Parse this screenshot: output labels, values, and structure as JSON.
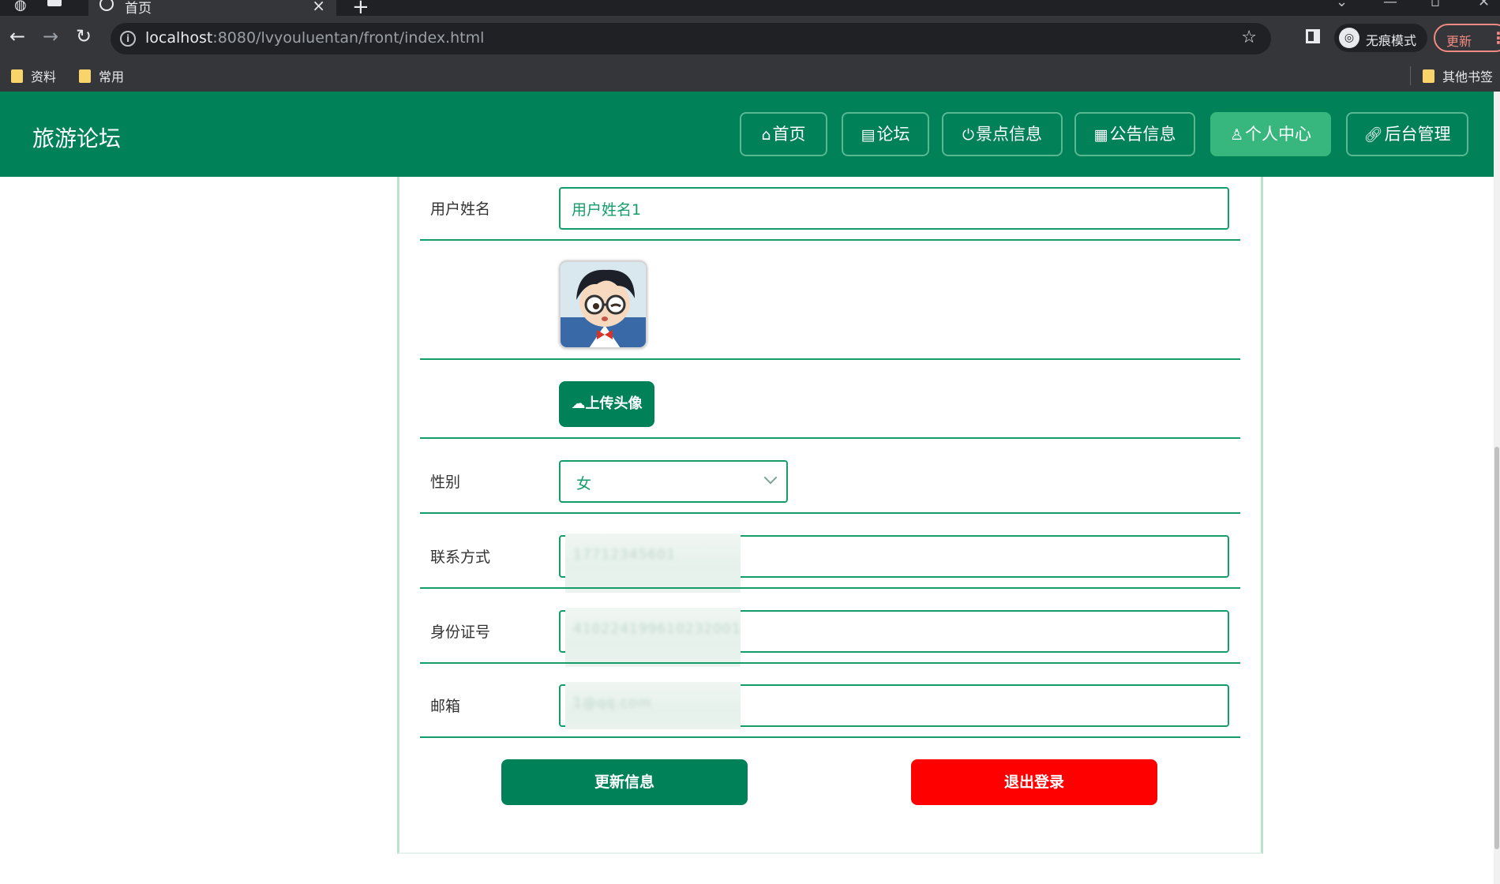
{
  "browser": {
    "tab_title": "首页",
    "tab_close": "×",
    "new_tab": "+",
    "url_host": "localhost",
    "url_rest": ":8080/lvyouluentan/front/index.html",
    "incognito_label": "无痕模式",
    "update_label": "更新",
    "menu_dots": "⋮",
    "bookmarks": [
      "资料",
      "常用"
    ],
    "other_bookmarks": "其他书签"
  },
  "header": {
    "brand": "旅游论坛",
    "nav": [
      {
        "label": "首页",
        "icon": "home-icon",
        "active": false
      },
      {
        "label": "论坛",
        "icon": "document-icon",
        "active": false
      },
      {
        "label": "景点信息",
        "icon": "power-icon",
        "active": false
      },
      {
        "label": "公告信息",
        "icon": "grid-icon",
        "active": false
      },
      {
        "label": "个人中心",
        "icon": "user-icon",
        "active": true
      },
      {
        "label": "后台管理",
        "icon": "link-icon",
        "active": false
      }
    ]
  },
  "form": {
    "name_label": "用户姓名",
    "name_value": "用户姓名1",
    "upload_label": "上传头像",
    "gender_label": "性别",
    "gender_value": "女",
    "phone_label": "联系方式",
    "phone_value": "17712345601",
    "idcard_label": "身份证号",
    "idcard_value": "410224199610232001",
    "email_label": "邮箱",
    "email_value": "1@qq.com",
    "update_button": "更新信息",
    "logout_button": "退出登录"
  },
  "colors": {
    "brand_green": "#018158",
    "active_nav": "#37b77d",
    "field_border": "#139d68",
    "logout_red": "#ff0000"
  }
}
